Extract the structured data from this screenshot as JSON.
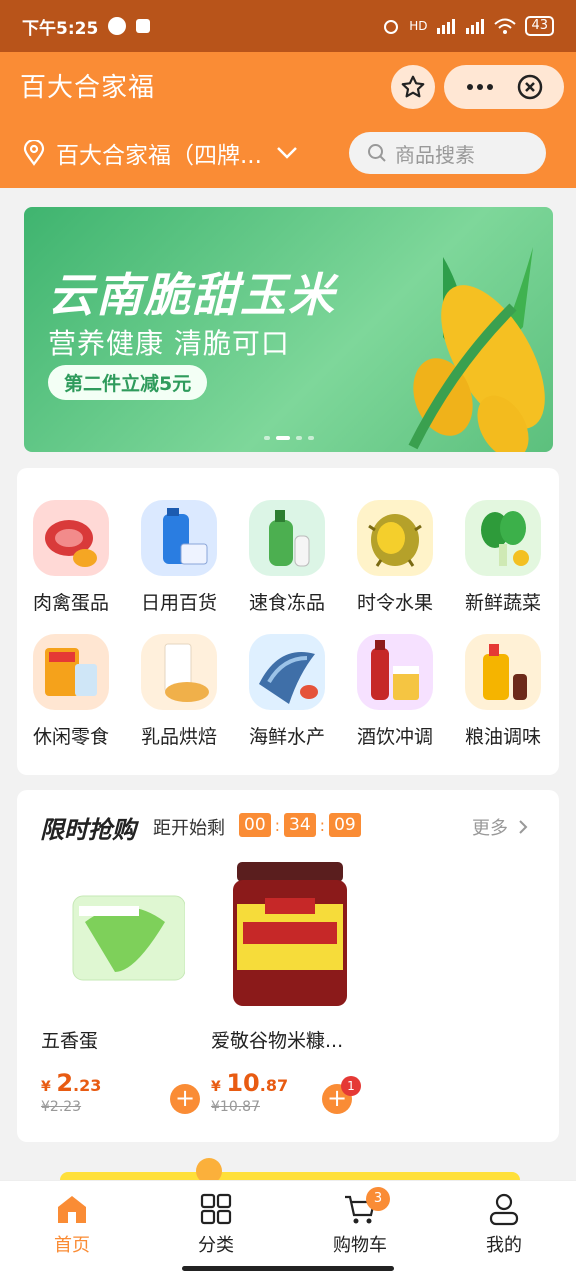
{
  "status_bar": {
    "time": "下午5:25",
    "network": "HD",
    "battery": "43"
  },
  "navbar": {
    "title": "百大合家福"
  },
  "location": {
    "label": "百大合家福（四牌...",
    "search_placeholder": "商品搜素"
  },
  "banner": {
    "title": "云南脆甜玉米",
    "subtitle": "营养健康 清脆可口",
    "promo": "第二件立减5元",
    "active_slide": 2,
    "slide_count": 4
  },
  "categories": [
    {
      "label": "肉禽蛋品",
      "icon": "meat-icon"
    },
    {
      "label": "日用百货",
      "icon": "daily-goods-icon"
    },
    {
      "label": "速食冻品",
      "icon": "frozen-food-icon"
    },
    {
      "label": "时令水果",
      "icon": "fruit-icon"
    },
    {
      "label": "新鲜蔬菜",
      "icon": "vegetable-icon"
    },
    {
      "label": "休闲零食",
      "icon": "snack-icon"
    },
    {
      "label": "乳品烘焙",
      "icon": "dairy-icon"
    },
    {
      "label": "海鲜水产",
      "icon": "seafood-icon"
    },
    {
      "label": "酒饮冲调",
      "icon": "drinks-icon"
    },
    {
      "label": "粮油调味",
      "icon": "grain-oil-icon"
    }
  ],
  "flash_sale": {
    "title": "限时抢购",
    "countdown_label": "距开始剩",
    "timer": [
      "00",
      "34",
      "09"
    ],
    "more": "更多",
    "products": [
      {
        "name": "五香蛋",
        "currency": "¥",
        "price_int": "2",
        "price_dec": ".23",
        "old_price": "¥2.23",
        "cart_count": ""
      },
      {
        "name": "爱敬谷物米糠...",
        "currency": "¥",
        "price_int": "10",
        "price_dec": ".87",
        "old_price": "¥10.87",
        "cart_count": "1"
      }
    ]
  },
  "tabbar": {
    "items": [
      {
        "label": "首页",
        "icon": "home-icon"
      },
      {
        "label": "分类",
        "icon": "category-icon"
      },
      {
        "label": "购物车",
        "icon": "cart-icon",
        "badge": "3"
      },
      {
        "label": "我的",
        "icon": "profile-icon"
      }
    ]
  },
  "colors": {
    "accent": "#fa8c35",
    "status_bar": "#b8541a",
    "price": "#e85b12"
  }
}
